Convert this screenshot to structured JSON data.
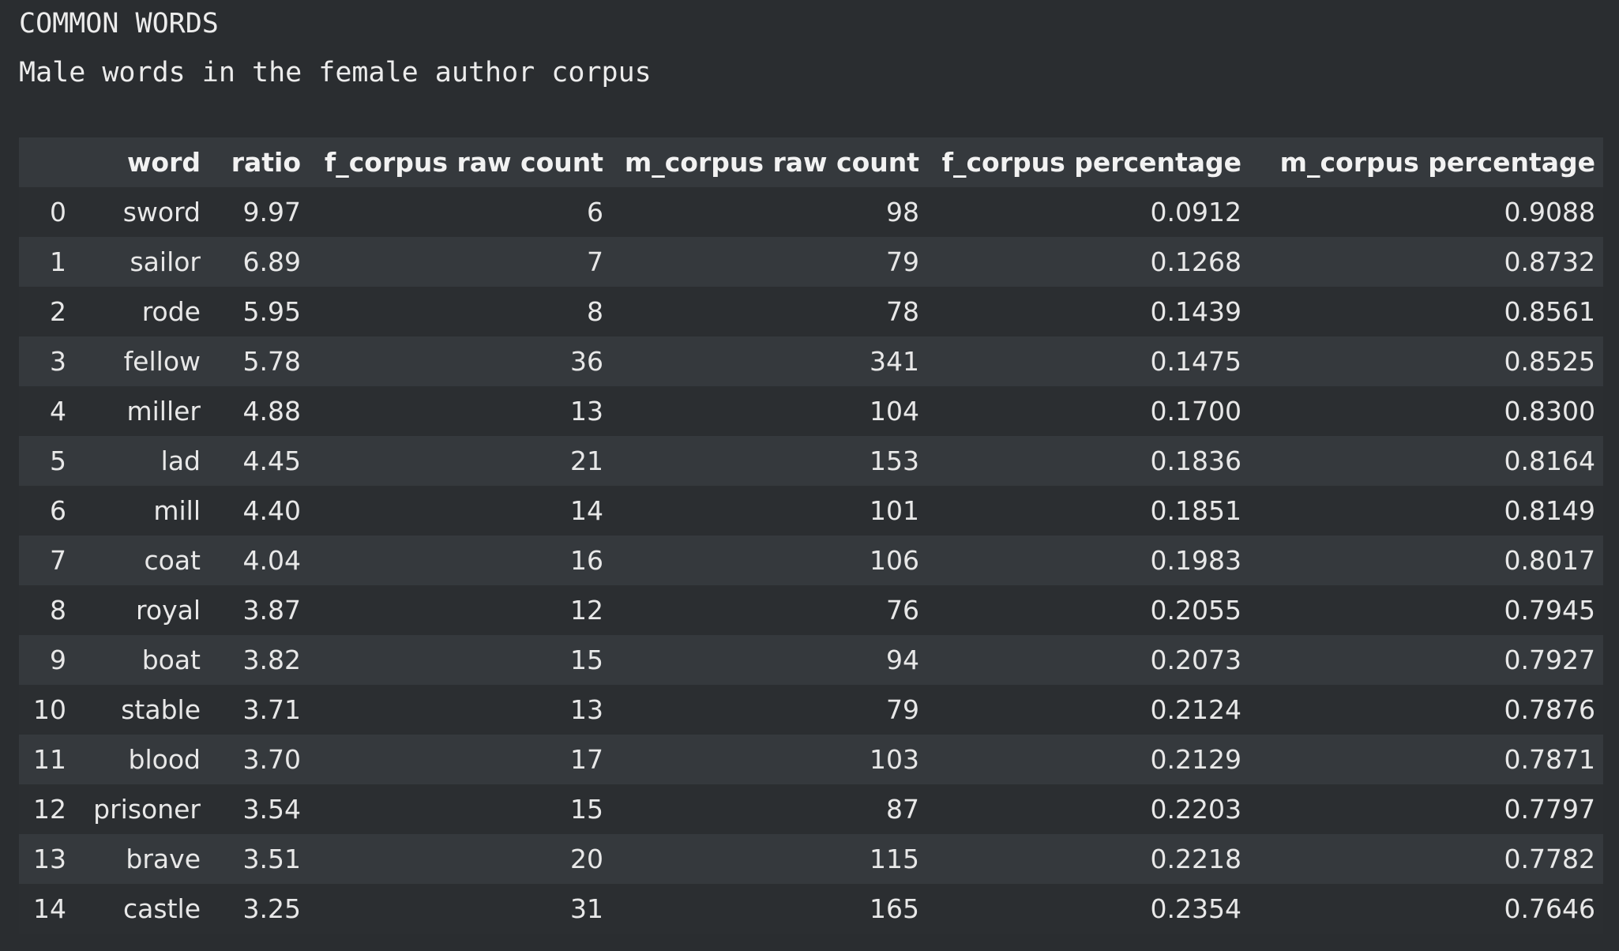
{
  "output": {
    "title": "COMMON WORDS",
    "subtitle": "Male words in the female author corpus"
  },
  "table": {
    "columns": [
      "",
      "word",
      "ratio",
      "f_corpus raw count",
      "m_corpus raw count",
      "f_corpus percentage",
      "m_corpus percentage"
    ],
    "rows": [
      [
        "0",
        "sword",
        "9.97",
        "6",
        "98",
        "0.0912",
        "0.9088"
      ],
      [
        "1",
        "sailor",
        "6.89",
        "7",
        "79",
        "0.1268",
        "0.8732"
      ],
      [
        "2",
        "rode",
        "5.95",
        "8",
        "78",
        "0.1439",
        "0.8561"
      ],
      [
        "3",
        "fellow",
        "5.78",
        "36",
        "341",
        "0.1475",
        "0.8525"
      ],
      [
        "4",
        "miller",
        "4.88",
        "13",
        "104",
        "0.1700",
        "0.8300"
      ],
      [
        "5",
        "lad",
        "4.45",
        "21",
        "153",
        "0.1836",
        "0.8164"
      ],
      [
        "6",
        "mill",
        "4.40",
        "14",
        "101",
        "0.1851",
        "0.8149"
      ],
      [
        "7",
        "coat",
        "4.04",
        "16",
        "106",
        "0.1983",
        "0.8017"
      ],
      [
        "8",
        "royal",
        "3.87",
        "12",
        "76",
        "0.2055",
        "0.7945"
      ],
      [
        "9",
        "boat",
        "3.82",
        "15",
        "94",
        "0.2073",
        "0.7927"
      ],
      [
        "10",
        "stable",
        "3.71",
        "13",
        "79",
        "0.2124",
        "0.7876"
      ],
      [
        "11",
        "blood",
        "3.70",
        "17",
        "103",
        "0.2129",
        "0.7871"
      ],
      [
        "12",
        "prisoner",
        "3.54",
        "15",
        "87",
        "0.2203",
        "0.7797"
      ],
      [
        "13",
        "brave",
        "3.51",
        "20",
        "115",
        "0.2218",
        "0.7782"
      ],
      [
        "14",
        "castle",
        "3.25",
        "31",
        "165",
        "0.2354",
        "0.7646"
      ]
    ]
  },
  "colors": {
    "background": "#2a2d30",
    "row_alt": "#35393d",
    "text": "#e8e8e8"
  }
}
